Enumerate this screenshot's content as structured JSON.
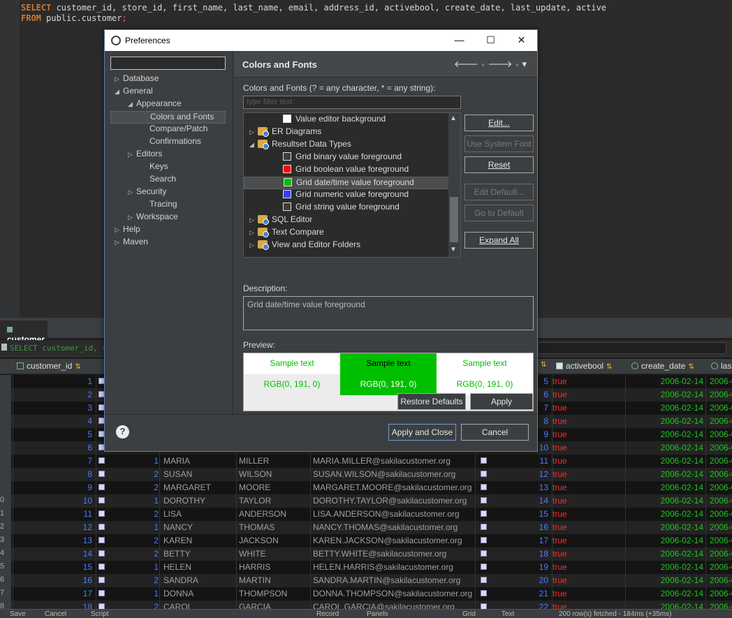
{
  "editor": {
    "line1_kw": "SELECT",
    "line1_rest": " customer_id, store_id, first_name, last_name, email, address_id, activebool, create_date, last_update, active",
    "line2_kw": "FROM",
    "line2_rest": " public.customer",
    "line2_semi": ";"
  },
  "results": {
    "tab_label": "customer",
    "filter_text": "SELECT customer_id, stor",
    "columns": {
      "customer_id": "customer_id",
      "activebool": "activebool",
      "create_date": "create_date",
      "last": "las"
    },
    "rows": [
      {
        "n": "",
        "id": "1",
        "store": "",
        "first": "",
        "last": "",
        "email": "",
        "addr": "5",
        "active": "true",
        "date": "2006-02-14",
        "upd": "2006-0"
      },
      {
        "n": "",
        "id": "2",
        "store": "",
        "first": "",
        "last": "",
        "email": "",
        "addr": "6",
        "active": "true",
        "date": "2006-02-14",
        "upd": "2006-0"
      },
      {
        "n": "",
        "id": "3",
        "store": "",
        "first": "",
        "last": "",
        "email": "",
        "addr": "7",
        "active": "true",
        "date": "2006-02-14",
        "upd": "2006-0"
      },
      {
        "n": "",
        "id": "4",
        "store": "",
        "first": "",
        "last": "",
        "email": "",
        "addr": "8",
        "active": "true",
        "date": "2006-02-14",
        "upd": "2006-0"
      },
      {
        "n": "",
        "id": "5",
        "store": "",
        "first": "",
        "last": "",
        "email": "",
        "addr": "9",
        "active": "true",
        "date": "2006-02-14",
        "upd": "2006-0"
      },
      {
        "n": "",
        "id": "6",
        "store": "",
        "first": "",
        "last": "",
        "email": "",
        "addr": "10",
        "active": "true",
        "date": "2006-02-14",
        "upd": "2006-0"
      },
      {
        "n": "",
        "id": "7",
        "store": "1",
        "first": "MARIA",
        "last": "MILLER",
        "email": "MARIA.MILLER@sakilacustomer.org",
        "addr": "11",
        "active": "true",
        "date": "2006-02-14",
        "upd": "2006-0"
      },
      {
        "n": "",
        "id": "8",
        "store": "2",
        "first": "SUSAN",
        "last": "WILSON",
        "email": "SUSAN.WILSON@sakilacustomer.org",
        "addr": "12",
        "active": "true",
        "date": "2006-02-14",
        "upd": "2006-0"
      },
      {
        "n": "",
        "id": "9",
        "store": "2",
        "first": "MARGARET",
        "last": "MOORE",
        "email": "MARGARET.MOORE@sakilacustomer.org",
        "addr": "13",
        "active": "true",
        "date": "2006-02-14",
        "upd": "2006-0"
      },
      {
        "n": "0",
        "id": "10",
        "store": "1",
        "first": "DOROTHY",
        "last": "TAYLOR",
        "email": "DOROTHY.TAYLOR@sakilacustomer.org",
        "addr": "14",
        "active": "true",
        "date": "2006-02-14",
        "upd": "2006-0"
      },
      {
        "n": "1",
        "id": "11",
        "store": "2",
        "first": "LISA",
        "last": "ANDERSON",
        "email": "LISA.ANDERSON@sakilacustomer.org",
        "addr": "15",
        "active": "true",
        "date": "2006-02-14",
        "upd": "2006-0"
      },
      {
        "n": "2",
        "id": "12",
        "store": "1",
        "first": "NANCY",
        "last": "THOMAS",
        "email": "NANCY.THOMAS@sakilacustomer.org",
        "addr": "16",
        "active": "true",
        "date": "2006-02-14",
        "upd": "2006-0"
      },
      {
        "n": "3",
        "id": "13",
        "store": "2",
        "first": "KAREN",
        "last": "JACKSON",
        "email": "KAREN.JACKSON@sakilacustomer.org",
        "addr": "17",
        "active": "true",
        "date": "2006-02-14",
        "upd": "2006-0"
      },
      {
        "n": "4",
        "id": "14",
        "store": "2",
        "first": "BETTY",
        "last": "WHITE",
        "email": "BETTY.WHITE@sakilacustomer.org",
        "addr": "18",
        "active": "true",
        "date": "2006-02-14",
        "upd": "2006-0"
      },
      {
        "n": "5",
        "id": "15",
        "store": "1",
        "first": "HELEN",
        "last": "HARRIS",
        "email": "HELEN.HARRIS@sakilacustomer.org",
        "addr": "19",
        "active": "true",
        "date": "2006-02-14",
        "upd": "2006-0"
      },
      {
        "n": "6",
        "id": "16",
        "store": "2",
        "first": "SANDRA",
        "last": "MARTIN",
        "email": "SANDRA.MARTIN@sakilacustomer.org",
        "addr": "20",
        "active": "true",
        "date": "2006-02-14",
        "upd": "2006-0"
      },
      {
        "n": "7",
        "id": "17",
        "store": "1",
        "first": "DONNA",
        "last": "THOMPSON",
        "email": "DONNA.THOMPSON@sakilacustomer.org",
        "addr": "21",
        "active": "true",
        "date": "2006-02-14",
        "upd": "2006-0"
      },
      {
        "n": "8",
        "id": "18",
        "store": "2",
        "first": "CAROL",
        "last": "GARCIA",
        "email": "CAROL.GARCIA@sakilacustomer.org",
        "addr": "22",
        "active": "true",
        "date": "2006-02-14",
        "upd": "2006-0"
      }
    ]
  },
  "statusbar": {
    "save": "Save",
    "cancel": "Cancel",
    "script": "Script",
    "record": "Record",
    "panels": "Panels",
    "grid": "Grid",
    "text": "Text",
    "fetched": "200 row(s) fetched - 184ms (+35ms)"
  },
  "dialog": {
    "title": "Preferences",
    "minimize": "—",
    "maximize": "☐",
    "close": "✕",
    "tree": [
      {
        "label": "Database",
        "arrow": "▷",
        "level": 0
      },
      {
        "label": "General",
        "arrow": "◢",
        "level": 0
      },
      {
        "label": "Appearance",
        "arrow": "◢",
        "level": 1
      },
      {
        "label": "Colors and Fonts",
        "arrow": "",
        "level": 2,
        "selected": true
      },
      {
        "label": "Compare/Patch",
        "arrow": "",
        "level": 2
      },
      {
        "label": "Confirmations",
        "arrow": "",
        "level": 2
      },
      {
        "label": "Editors",
        "arrow": "▷",
        "level": 1
      },
      {
        "label": "Keys",
        "arrow": "",
        "level": 2
      },
      {
        "label": "Search",
        "arrow": "",
        "level": 2
      },
      {
        "label": "Security",
        "arrow": "▷",
        "level": 1
      },
      {
        "label": "Tracing",
        "arrow": "",
        "level": 2
      },
      {
        "label": "Workspace",
        "arrow": "▷",
        "level": 1
      },
      {
        "label": "Help",
        "arrow": "▷",
        "level": 0
      },
      {
        "label": "Maven",
        "arrow": "▷",
        "level": 0
      }
    ],
    "page_title": "Colors and Fonts",
    "subtitle": "Colors and Fonts (? = any character, * = any string):",
    "filter_placeholder": "type filter text",
    "items": [
      {
        "label": "Value editor background",
        "kind": "swatch",
        "color": "#ffffff",
        "indent": 2,
        "arrow": ""
      },
      {
        "label": "ER Diagrams",
        "kind": "folder",
        "indent": 0,
        "arrow": "▷"
      },
      {
        "label": "Resultset Data Types",
        "kind": "folder",
        "indent": 0,
        "arrow": "◢"
      },
      {
        "label": "Grid binary value foreground",
        "kind": "swatch",
        "color": "#3c3c3c",
        "indent": 2,
        "arrow": ""
      },
      {
        "label": "Grid boolean value foreground",
        "kind": "swatch",
        "color": "#ff0000",
        "indent": 2,
        "arrow": ""
      },
      {
        "label": "Grid date/time value foreground",
        "kind": "swatch",
        "color": "#00bf00",
        "indent": 2,
        "arrow": "",
        "selected": true
      },
      {
        "label": "Grid numeric value foreground",
        "kind": "swatch",
        "color": "#3b3bff",
        "indent": 2,
        "arrow": ""
      },
      {
        "label": "Grid string value foreground",
        "kind": "swatch",
        "color": "#3c3c3c",
        "indent": 2,
        "arrow": ""
      },
      {
        "label": "SQL Editor",
        "kind": "folder",
        "indent": 0,
        "arrow": "▷"
      },
      {
        "label": "Text Compare",
        "kind": "folder",
        "indent": 0,
        "arrow": "▷"
      },
      {
        "label": "View and Editor Folders",
        "kind": "folder",
        "indent": 0,
        "arrow": "▷"
      }
    ],
    "buttons": {
      "edit": "Edit...",
      "use_system_font": "Use System Font",
      "reset": "Reset",
      "edit_default": "Edit Default...",
      "go_to_default": "Go to Default",
      "expand_all": "Expand All",
      "restore_defaults": "Restore Defaults",
      "apply": "Apply",
      "apply_close": "Apply and Close",
      "cancel": "Cancel"
    },
    "description_label": "Description:",
    "description": "Grid date/time value foreground",
    "preview_label": "Preview:",
    "preview": {
      "sample": "Sample text",
      "rgb": "RGB(0, 191, 0)",
      "color": "#00bf00"
    }
  }
}
